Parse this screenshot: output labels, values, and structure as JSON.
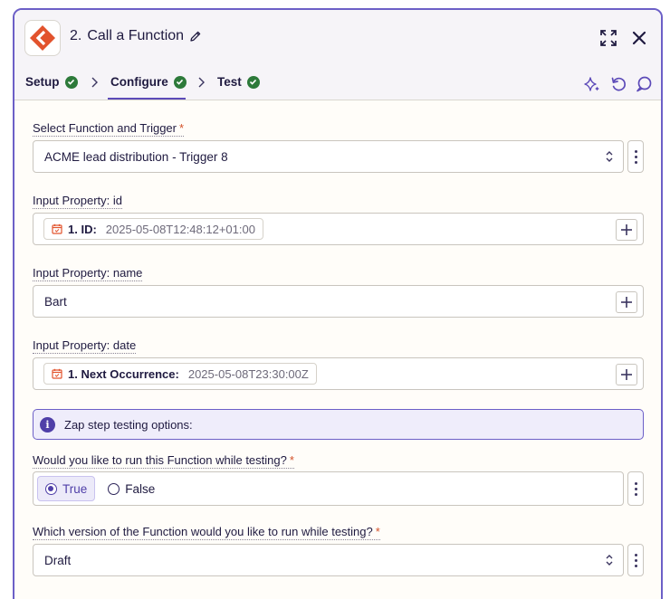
{
  "step": {
    "number": "2.",
    "title": "Call a Function"
  },
  "tabs": [
    {
      "label": "Setup"
    },
    {
      "label": "Configure"
    },
    {
      "label": "Test"
    }
  ],
  "colors": {
    "accent": "#5c4ab8",
    "success": "#2d7a3a",
    "brand": "#e2532d",
    "required": "#d4522a"
  },
  "fields": {
    "function_trigger": {
      "label": "Select Function and Trigger",
      "required": "*",
      "value": "ACME lead distribution - Trigger 8"
    },
    "prop_id": {
      "label": "Input Property: id",
      "pill_name": "1. ID:",
      "pill_value": "2025-05-08T12:48:12+01:00"
    },
    "prop_name": {
      "label": "Input Property: name",
      "value": "Bart"
    },
    "prop_date": {
      "label": "Input Property: date",
      "pill_name": "1. Next Occurrence:",
      "pill_value": "2025-05-08T23:30:00Z"
    }
  },
  "info": {
    "text": "Zap step testing options:"
  },
  "run_while_testing": {
    "label": "Would you like to run this Function while testing?",
    "required": "*",
    "options": [
      "True",
      "False"
    ],
    "selected": "True"
  },
  "version": {
    "label": "Which version of the Function would you like to run while testing?",
    "required": "*",
    "value": "Draft"
  }
}
